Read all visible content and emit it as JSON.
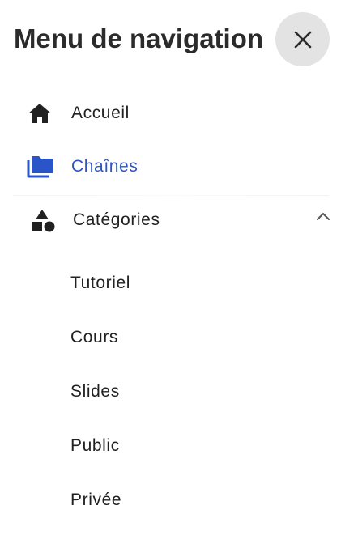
{
  "header": {
    "title": "Menu de navigation",
    "close_icon": "close-icon"
  },
  "nav": {
    "items": [
      {
        "label": "Accueil",
        "icon": "home-icon",
        "active": false
      },
      {
        "label": "Chaînes",
        "icon": "folders-icon",
        "active": true
      },
      {
        "label": "Catégories",
        "icon": "category-shapes-icon",
        "active": false,
        "expanded": true
      }
    ]
  },
  "categories": {
    "items": [
      "Tutoriel",
      "Cours",
      "Slides",
      "Public",
      "Privée"
    ]
  },
  "colors": {
    "accent": "#2a55c8",
    "text": "#212121",
    "close_bg": "#e3e3e3"
  }
}
